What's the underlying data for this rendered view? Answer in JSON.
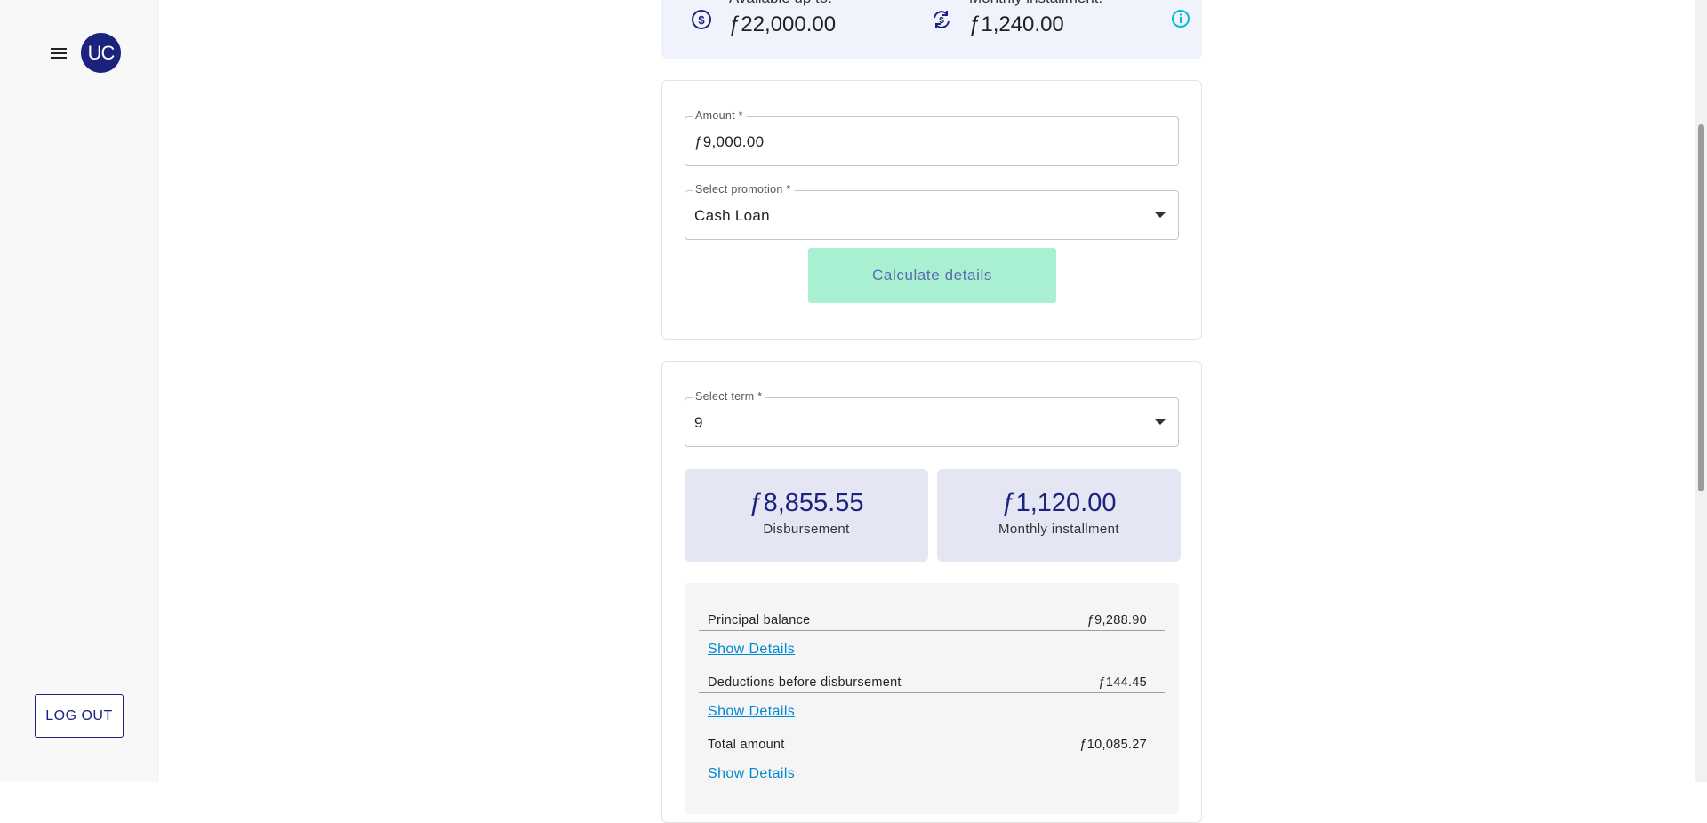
{
  "sidebar": {
    "avatar_initials": "UC",
    "logout_label": "LOG OUT"
  },
  "summary": {
    "available_label": "Available up to:",
    "available_value": "ƒ22,000.00",
    "installment_label": "Monthly installment:",
    "installment_value": "ƒ1,240.00"
  },
  "loan_form": {
    "amount_label": "Amount *",
    "amount_value": "ƒ9,000.00",
    "promotion_label": "Select promotion *",
    "promotion_value": "Cash Loan",
    "calculate_label": "Calculate details"
  },
  "term": {
    "label": "Select term *",
    "value": "9"
  },
  "results": {
    "disbursement_value": "ƒ8,855.55",
    "disbursement_label": "Disbursement",
    "monthly_value": "ƒ1,120.00",
    "monthly_label": "Monthly installment"
  },
  "breakdown": [
    {
      "label": "Principal balance",
      "amount": "ƒ9,288.90",
      "link": "Show Details"
    },
    {
      "label": "Deductions before disbursement",
      "amount": "ƒ144.45",
      "link": "Show Details"
    },
    {
      "label": "Total amount",
      "amount": "ƒ10,085.27",
      "link": "Show Details"
    }
  ],
  "colors": {
    "brand": "#1a237e",
    "accent_button": "#a9efd2",
    "link": "#0288d1",
    "info": "#00bcd4"
  }
}
